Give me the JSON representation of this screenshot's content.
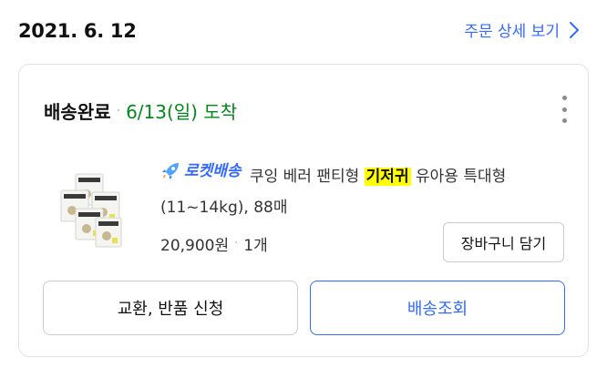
{
  "order": {
    "date": "2021. 6. 12",
    "detail_link": "주문 상세 보기"
  },
  "shipment": {
    "status": "배송완료",
    "separator": "·",
    "arrival": "6/13(일) 도착"
  },
  "product": {
    "badge": "로켓배송",
    "name_before": " 쿠잉 베러 팬티형 ",
    "keyword": "기저귀",
    "name_after": " 유아용 특대형 (11~14kg), 88매",
    "price": "20,900원",
    "separator": "·",
    "quantity": "1개",
    "image_alt": "product-thumbnail"
  },
  "buttons": {
    "add_to_cart": "장바구니 담기",
    "exchange_return": "교환, 반품 신청",
    "track_delivery": "배송조회"
  },
  "colors": {
    "accent": "#346aff",
    "delivered": "#00891a",
    "highlight": "#ffff00"
  },
  "icons": {
    "detail_link": "chevron-right-icon",
    "menu": "more-vertical-icon",
    "badge": "rocket-icon"
  }
}
